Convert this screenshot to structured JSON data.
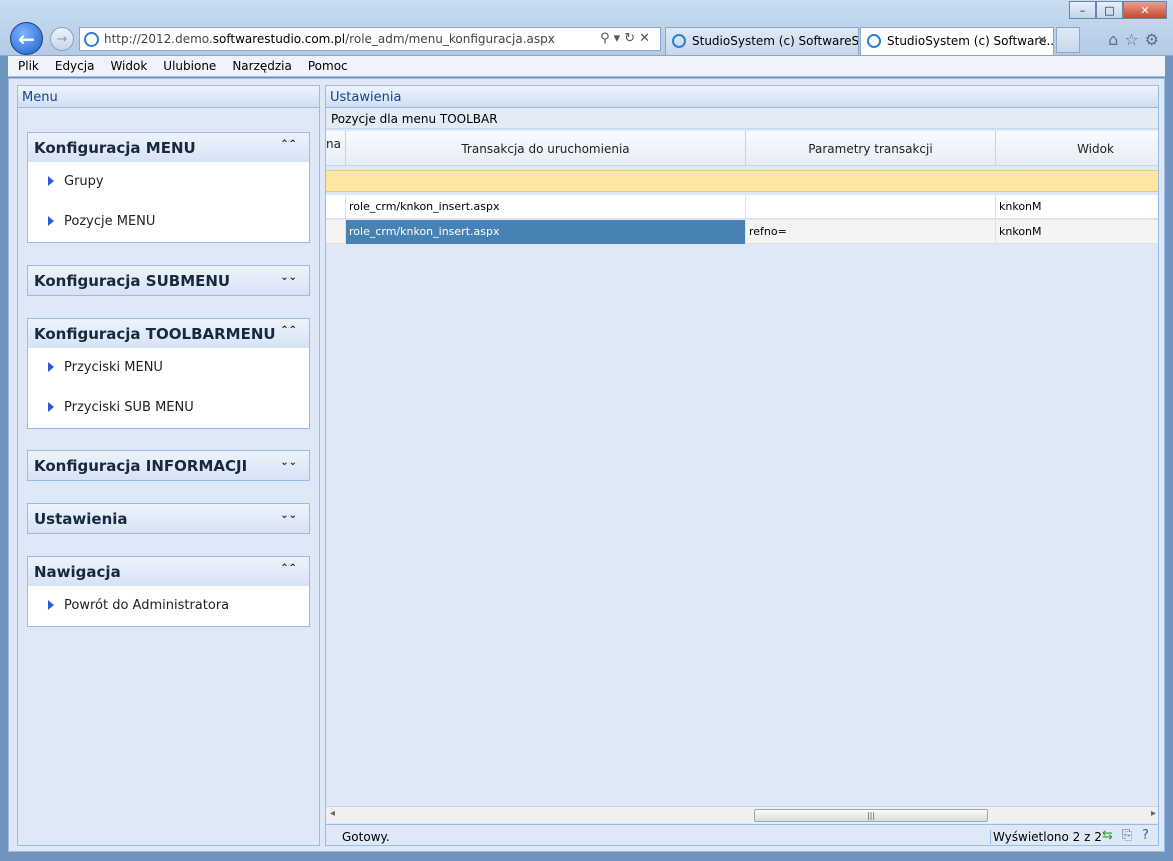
{
  "window": {
    "url_prefix": "http://2012.demo.",
    "url_domain": "softwarestudio.com.pl",
    "url_path": "/role_adm/menu_konfiguracja.aspx",
    "tabs": [
      {
        "label": "StudioSystem (c) SoftwareStu..."
      },
      {
        "label": "StudioSystem (c) Software..."
      }
    ]
  },
  "menubar": [
    "Plik",
    "Edycja",
    "Widok",
    "Ulubione",
    "Narzędzia",
    "Pomoc"
  ],
  "west": {
    "title": "Menu",
    "sections": [
      {
        "title": "Konfiguracja MENU",
        "items": [
          "Grupy",
          "Pozycje MENU"
        ]
      },
      {
        "title": "Konfiguracja SUBMENU",
        "items": []
      },
      {
        "title": "Konfiguracja TOOLBARMENU",
        "items": [
          "Przyciski MENU",
          "Przyciski SUB MENU"
        ]
      },
      {
        "title": "Konfiguracja INFORMACJI",
        "items": []
      },
      {
        "title": "Ustawienia",
        "items": []
      },
      {
        "title": "Nawigacja",
        "items": [
          "Powrót do Administratora"
        ]
      }
    ]
  },
  "center": {
    "title": "Ustawienia",
    "subtitle": "Pozycje dla menu TOOLBAR",
    "columns": [
      "na",
      "Transakcja do uruchomienia",
      "Parametry transakcji",
      "Widok"
    ],
    "rows": [
      [
        "",
        "role_crm/knkon_insert.aspx",
        "",
        "knkonM"
      ],
      [
        "",
        "role_crm/knkon_insert.aspx",
        "refno=",
        "knkonM"
      ]
    ],
    "status_ready": "Gotowy.",
    "status_count": "Wyświetlono 2 z 2"
  }
}
